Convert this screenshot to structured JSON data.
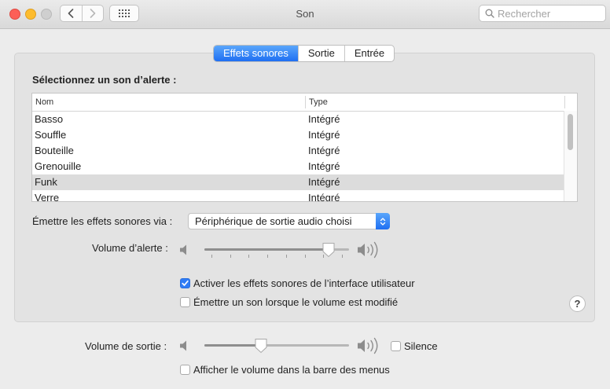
{
  "window": {
    "title": "Son"
  },
  "toolbar": {
    "search_placeholder": "Rechercher",
    "back_icon": "chevron-left-icon",
    "forward_icon": "chevron-right-icon",
    "grid_icon": "grid-icon"
  },
  "tabs": [
    {
      "label": "Effets sonores",
      "active": true
    },
    {
      "label": "Sortie",
      "active": false
    },
    {
      "label": "Entrée",
      "active": false
    }
  ],
  "effects": {
    "select_label": "Sélectionnez un son d’alerte :",
    "table": {
      "columns": [
        "Nom",
        "Type"
      ],
      "rows": [
        {
          "name": "Basso",
          "type": "Intégré",
          "selected": false
        },
        {
          "name": "Souffle",
          "type": "Intégré",
          "selected": false
        },
        {
          "name": "Bouteille",
          "type": "Intégré",
          "selected": false
        },
        {
          "name": "Grenouille",
          "type": "Intégré",
          "selected": false
        },
        {
          "name": "Funk",
          "type": "Intégré",
          "selected": true
        },
        {
          "name": "Verre",
          "type": "Intégré",
          "selected": false
        }
      ]
    },
    "play_via_label": "Émettre les effets sonores via :",
    "play_via_value": "Périphérique de sortie audio choisi",
    "alert_volume_label": "Volume d’alerte :",
    "alert_volume": 0.9,
    "ui_sounds_label": "Activer les effets sonores de l’interface utilisateur",
    "ui_sounds_checked": true,
    "volume_feedback_label": "Émettre un son lorsque le volume est modifié",
    "volume_feedback_checked": false,
    "help": "?"
  },
  "output": {
    "volume_label": "Volume de sortie :",
    "volume": 0.38,
    "mute_label": "Silence",
    "mute_checked": false,
    "menu_bar_label": "Afficher le volume dans la barre des menus",
    "menu_bar_checked": false
  },
  "colors": {
    "accent": "#2f7cf6",
    "close": "#fc5f57",
    "minimize": "#fdbc2e",
    "zoom": "#cfcfcf"
  }
}
